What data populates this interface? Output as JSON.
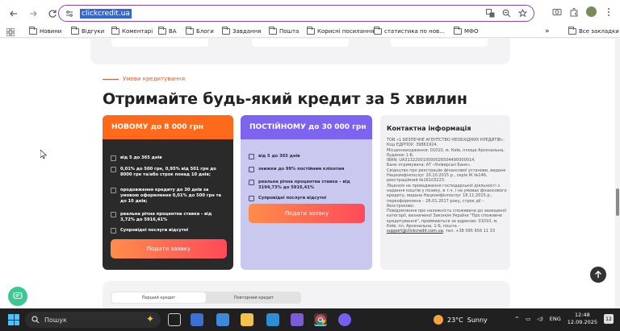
{
  "browser": {
    "url": "clickcredit.ua",
    "bookmarks": [
      {
        "label": "Новини",
        "icon": "folder-icon"
      },
      {
        "label": "Відгуки",
        "icon": "folder-icon"
      },
      {
        "label": "Коментарі",
        "icon": "folder-icon"
      },
      {
        "label": "ВА",
        "icon": "folder-icon"
      },
      {
        "label": "Блоги",
        "icon": "folder-icon"
      },
      {
        "label": "Завдання",
        "icon": "folder-icon"
      },
      {
        "label": "Пошта",
        "icon": "folder-icon"
      },
      {
        "label": "Корисні посилання",
        "icon": "folder-icon"
      },
      {
        "label": "статистика по нов...",
        "icon": "folder-icon"
      },
      {
        "label": "МФО",
        "icon": "folder-icon"
      }
    ],
    "all_bookmarks": "Все закладки",
    "more_bookmarks": "»"
  },
  "page": {
    "subtitle": "Умови кредитування",
    "heading": "Отримайте будь-який кредит за 5 хвилин",
    "cards": [
      {
        "title": "НОВОМУ до 8 000 грн",
        "rows": [
          "від 5 до 365 днів",
          "0,01% до 500 грн, 0,95% від 501 грн до 8000 грн та/або строк понад 10 днів;",
          "продовження кредиту до 30 днів за умовою оформлення 0,01% до 500 грн та до 10 днів;",
          "реальна річна процентна ставка - від 3,72% до 5916,41%",
          "Супровідні послуги відсутні"
        ],
        "button": "Подати заявку"
      },
      {
        "title": "ПОСТІЙНОМУ до 30 000 грн",
        "rows": [
          "від 5 до 365 днів",
          "знижки до 99% постійним клієнтам",
          "реальна річна процентна ставка – від 3194,73% до 5916,41%",
          "Супровідні послуги відсутні"
        ],
        "button": "Подати заявку"
      }
    ],
    "contact": {
      "title": "Контактна інформація",
      "lines": [
        "ТОВ «1 БЕЗПЕЧНЕ АГЕНТСТВО НЕОБХІДНИХ КРЕДИТІВ».",
        "Код ЄДРПОУ: 39861924.",
        "Місцезнаходження: 01010, м. Київ, площа Арсенальна, будинок 1-Б.",
        "IBAN: UA313220010000026504490000014.",
        "Банк отримувача: АТ «Універсал Банк».",
        "Свідоцтво про реєстрацію фінансової установи, видане Нацкомфінпослуг 20.10.2015 р., серія ІК №146, реєстраційний №16103223.",
        "Ліцензія на провадження господарської діяльності з надання коштів у позику, в т.ч. і на умовах фінансового кредиту, видана Нацкомфінпослуг 18.11.2015 р., переоформлена – 26.01.2017 року, строк дії – безстроково.",
        "Повідомлення про належність споживача до захищеної категорії, визначеної Законом України \"Про споживче кредитування\", приймаються за адресою: 01010, м. Київ, пл. Арсенальна, 1-Б, пошта –"
      ],
      "email": "support@clickcredit.com.ua",
      "phone_suffix": ", тел. +38 095 656 11 33"
    },
    "tabs": [
      "Перший кредит",
      "Повторний кредит"
    ]
  },
  "taskbar": {
    "search": "Пошук",
    "weather_temp": "23°C",
    "weather_text": "Sunny",
    "lang": "ENG",
    "time": "12:48",
    "date": "12.09.2025",
    "notifications": "12"
  }
}
